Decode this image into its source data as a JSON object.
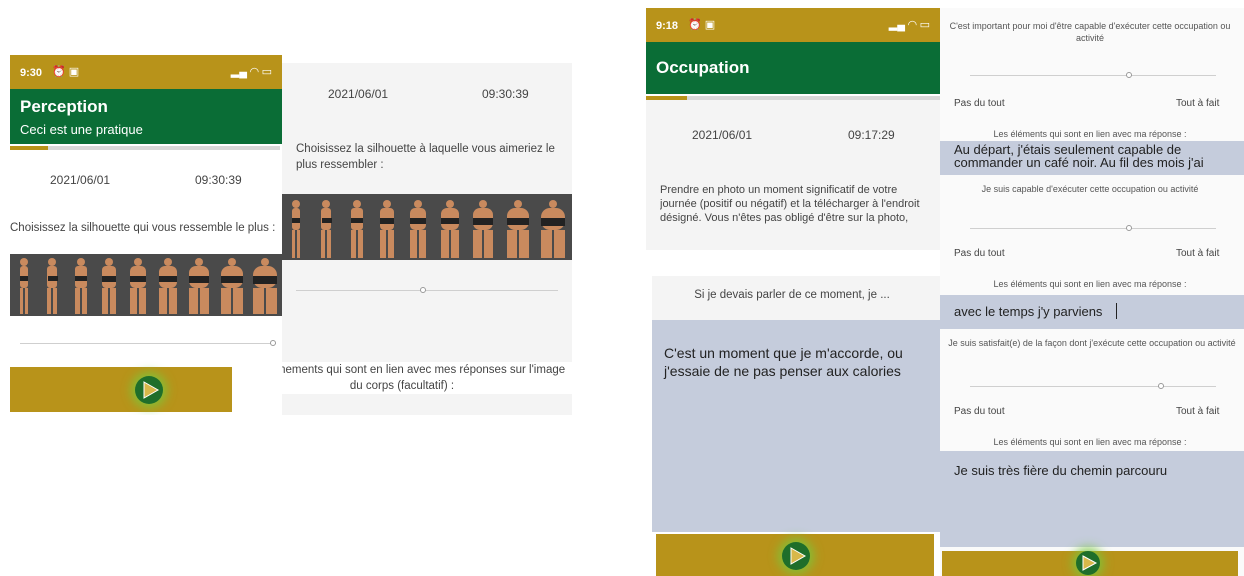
{
  "screen1": {
    "time": "9:30",
    "app_title": "Perception",
    "app_subtitle": "Ceci est une pratique",
    "date": "2021/06/01",
    "clock": "09:30:39",
    "question": "Choisissez la silhouette qui vous ressemble le plus :"
  },
  "screen2": {
    "date": "2021/06/01",
    "clock": "09:30:39",
    "question": "Choisissez la silhouette à laquelle vous aimeriez le plus ressembler :",
    "events_label": "Les évènements qui sont en lien avec mes réponses sur l'image du corps (facultatif) :"
  },
  "screen3": {
    "time": "9:18",
    "app_title": "Occupation",
    "date": "2021/06/01",
    "clock": "09:17:29",
    "instruction": "Prendre en photo un moment significatif de votre journée (positif ou négatif) et la télécharger à l'endroit désigné. Vous n'êtes pas obligé d'être sur la photo, cela",
    "prompt": "Si je devais parler de ce moment, je ...",
    "answer": "C'est un moment que je m'accorde, ou j'essaie de ne pas penser aux calories"
  },
  "screen4": {
    "q1": "C'est important pour moi d'être capable d'exécuter cette occupation ou activité",
    "low_label": "Pas du tout",
    "high_label": "Tout à fait",
    "elements_label": "Les éléments qui sont en lien avec ma réponse :",
    "a1": "Au départ, j'étais seulement capable de commander un café noir. Au fil des mois j'ai",
    "q2": "Je suis capable d'exécuter cette occupation ou activité",
    "a2": "avec le temps j'y parviens",
    "q3": "Je suis satisfait(e) de la façon dont j'exécute cette occupation ou activité",
    "a3": "Je suis très fière du chemin parcouru"
  }
}
